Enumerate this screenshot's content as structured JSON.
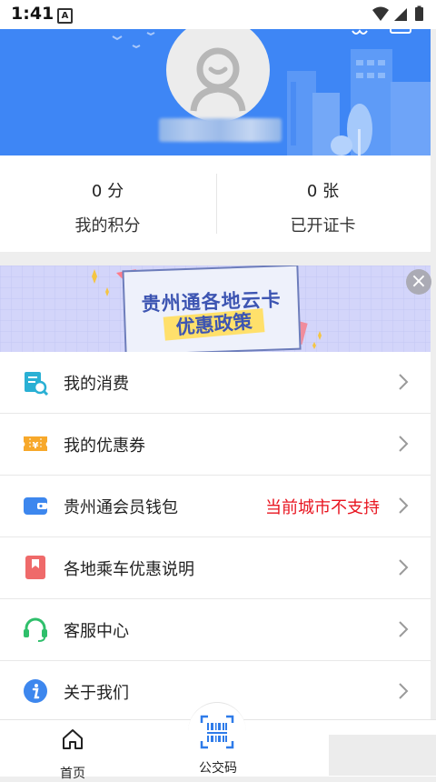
{
  "status_bar": {
    "time": "1:41",
    "notification_letter": "A"
  },
  "profile": {
    "username": ""
  },
  "stats": [
    {
      "value": "0 分",
      "label": "我的积分"
    },
    {
      "value": "0 张",
      "label": "已开证卡"
    }
  ],
  "banner": {
    "title": "贵州通各地云卡",
    "subtitle": "优惠政策",
    "close_symbol": "×"
  },
  "menu": [
    {
      "label": "我的消费",
      "note": "",
      "icon": "receipt-search-icon"
    },
    {
      "label": "我的优惠券",
      "note": "",
      "icon": "coupon-icon"
    },
    {
      "label": "贵州通会员钱包",
      "note": "当前城市不支持",
      "icon": "wallet-icon"
    },
    {
      "label": "各地乘车优惠说明",
      "note": "",
      "icon": "bookmark-icon"
    },
    {
      "label": "客服中心",
      "note": "",
      "icon": "headset-icon"
    },
    {
      "label": "关于我们",
      "note": "",
      "icon": "info-icon"
    }
  ],
  "colors": {
    "header_blue": "#3e86f5",
    "note_red": "#e8141f"
  },
  "bottom_nav": [
    {
      "label": "首页",
      "icon": "home-icon"
    },
    {
      "label": "公交码",
      "icon": "barcode-scan-icon"
    }
  ]
}
